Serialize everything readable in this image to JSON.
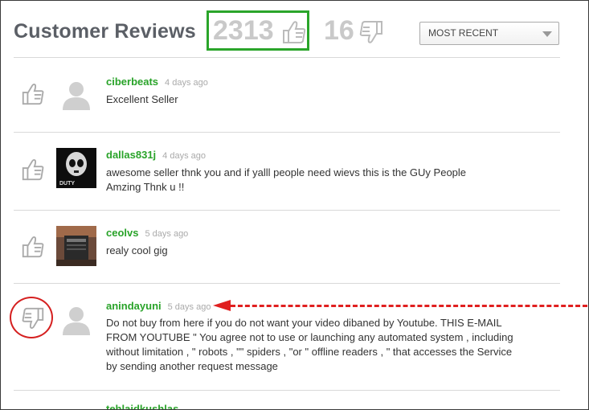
{
  "header": {
    "title": "Customer Reviews",
    "positive_count": "2313",
    "negative_count": "16",
    "sort_label": "MOST RECENT"
  },
  "reviews": [
    {
      "vote": "up",
      "username": "ciberbeats",
      "time": "4 days ago",
      "text": "Excellent Seller",
      "avatar": "default-person"
    },
    {
      "vote": "up",
      "username": "dallas831j",
      "time": "4 days ago",
      "text": "awesome seller thnk you and if yalll people need wievs this is the GUy People Amzing Thnk u !!",
      "avatar": "skull-image"
    },
    {
      "vote": "up",
      "username": "ceolvs",
      "time": "5 days ago",
      "text": "realy cool gig",
      "avatar": "photo-image"
    },
    {
      "vote": "down",
      "username": "anindayuni",
      "time": "5 days ago",
      "text": "Do not buy from here if you do not want your video dibaned by Youtube. THIS E-MAIL FROM YOUTUBE \" You agree not to use or launching any automated system , including without limitation , \" robots , \"\" spiders , \"or \" offline readers , \" that accesses the Service by sending another request message",
      "avatar": "default-person"
    }
  ],
  "partial_next_username": "tehlaidkushlas",
  "annotation": {
    "highlight_color": "#2aa52a",
    "circle_color": "#d52020",
    "arrow_color": "#e02020"
  }
}
